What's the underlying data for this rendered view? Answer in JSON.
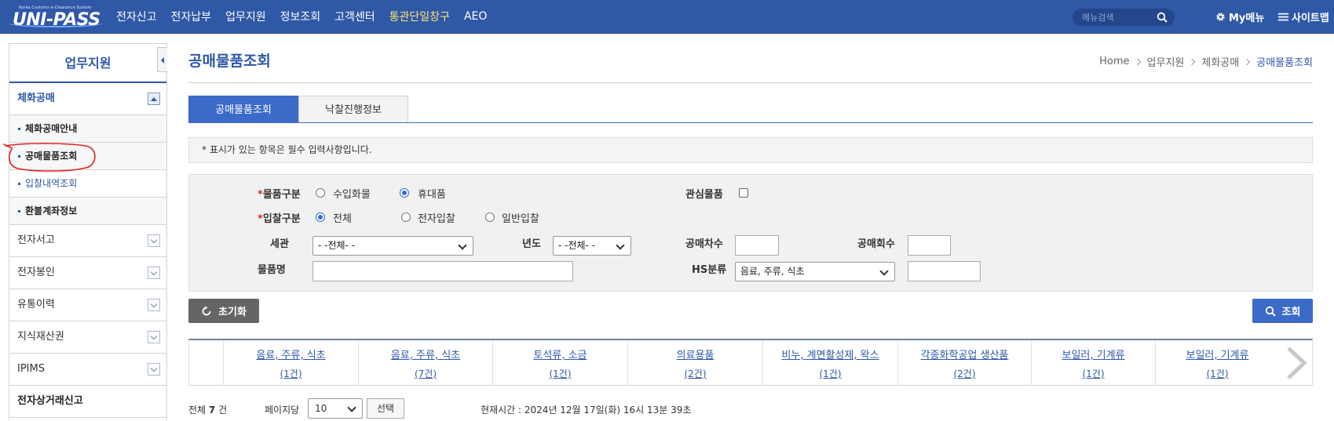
{
  "header": {
    "logo_sub": "Korea Customs e-Clearance System",
    "logo_main": "UNI-PASS",
    "nav": [
      "전자신고",
      "전자납부",
      "업무지원",
      "정보조회",
      "고객센터",
      "통관단일창구",
      "AEO"
    ],
    "search_placeholder": "메뉴검색",
    "mymenu": "My메뉴",
    "sitemap": "사이트맵"
  },
  "sidebar": {
    "title": "업무지원",
    "open_group": "체화공매",
    "sub_items": [
      "체화공매안내",
      "공매물품조회",
      "입찰내역조회",
      "환불계좌정보"
    ],
    "groups": [
      "전자서고",
      "전자봉인",
      "유통이력",
      "지식재산권",
      "IPIMS"
    ],
    "last_group": "전자상거래신고"
  },
  "page": {
    "title": "공매물품조회",
    "breadcrumb": [
      "Home",
      "업무지원",
      "체화공매",
      "공매물품조회"
    ],
    "tabs": [
      "공매물품조회",
      "낙찰진행정보"
    ],
    "notice": "* 표시가 있는 항목은 필수 입력사항입니다."
  },
  "form": {
    "goods_type_label": "물품구분",
    "goods_type_options": [
      "수입화물",
      "휴대품"
    ],
    "goods_type_selected": "휴대품",
    "interest_label": "관심물품",
    "bid_type_label": "입찰구분",
    "bid_type_options": [
      "전체",
      "전자입찰",
      "일반입찰"
    ],
    "bid_type_selected": "전체",
    "customs_label": "세관",
    "customs_value": "- -전체- -",
    "year_label": "년도",
    "year_value": "- -전체- -",
    "round_label": "공매차수",
    "count_label": "공매회수",
    "goods_name_label": "물품명",
    "hs_label": "HS분류",
    "hs_value": "음료, 주류, 식초",
    "required_mark": "*"
  },
  "buttons": {
    "reset": "초기화",
    "search": "조회"
  },
  "categories": [
    {
      "name": "음료, 주류, 식초",
      "count": "(1건)"
    },
    {
      "name": "음료, 주류, 식초",
      "count": "(7건)"
    },
    {
      "name": "토석류, 소금",
      "count": "(1건)"
    },
    {
      "name": "의료용품",
      "count": "(2건)"
    },
    {
      "name": "비누, 계면활성제, 왁스",
      "count": "(1건)"
    },
    {
      "name": "각종화학공업 생산품",
      "count": "(2건)"
    },
    {
      "name": "보일러, 기계류",
      "count": "(1건)"
    },
    {
      "name": "보일러, 기계류",
      "count": "(1건)"
    }
  ],
  "footer": {
    "total_prefix": "전체",
    "total_count": "7",
    "total_unit": "건",
    "per_page_label": "페이지당",
    "per_page_value": "10",
    "select_button": "선택",
    "current_time": "현재시간 : 2024년 12월 17일(화) 16시 13분 39초"
  },
  "colors": {
    "brand": "#2f58a7",
    "accent": "#3c6ac8",
    "annotation": "#e02020"
  }
}
